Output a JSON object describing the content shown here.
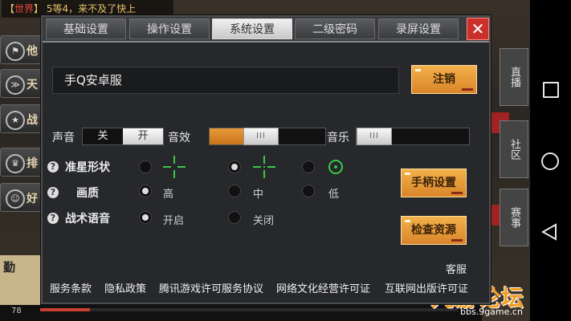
{
  "background": {
    "chat_channel": "世界",
    "chat_text": "5等4，来不及了快上",
    "left_items": [
      "他",
      "天",
      "战",
      "排",
      "好"
    ],
    "right_tabs": [
      "直播",
      "社区",
      "赛事"
    ],
    "bottom_card_text": "勤",
    "level_text": "78",
    "watermark_logo": "九游论坛",
    "watermark_url": "bbs.9game.cn"
  },
  "tabs": [
    {
      "label": "基础设置",
      "active": false
    },
    {
      "label": "操作设置",
      "active": false
    },
    {
      "label": "系统设置",
      "active": true
    },
    {
      "label": "二级密码",
      "active": false
    },
    {
      "label": "录屏设置",
      "active": false
    }
  ],
  "close_label": "✕",
  "server": {
    "name": "手Q安卓服",
    "logout_label": "注销"
  },
  "sound": {
    "label": "声音",
    "off_label": "关",
    "on_label": "开",
    "effects_label": "音效",
    "effects_level": 0.42,
    "music_label": "音乐",
    "music_level": 0.0,
    "handle_glyph": "III"
  },
  "crosshair": {
    "label": "准星形状",
    "selected_index": 0
  },
  "quality": {
    "label": "画质",
    "options": [
      "高",
      "中",
      "低"
    ],
    "selected_index": 0
  },
  "voice": {
    "label": "战术语音",
    "options": [
      "开启",
      "关闭"
    ],
    "selected_index": 0
  },
  "side_buttons": {
    "controller": "手柄设置",
    "check_resources": "检查资源"
  },
  "customer_service": "客服",
  "footer_links": [
    "服务条款",
    "隐私政策",
    "腾讯游戏许可服务协议",
    "网络文化经营许可证",
    "互联网出版许可证"
  ],
  "colors": {
    "accent": "#e89a3a",
    "crosshair": "#3cc74a",
    "close": "#c9302c"
  }
}
